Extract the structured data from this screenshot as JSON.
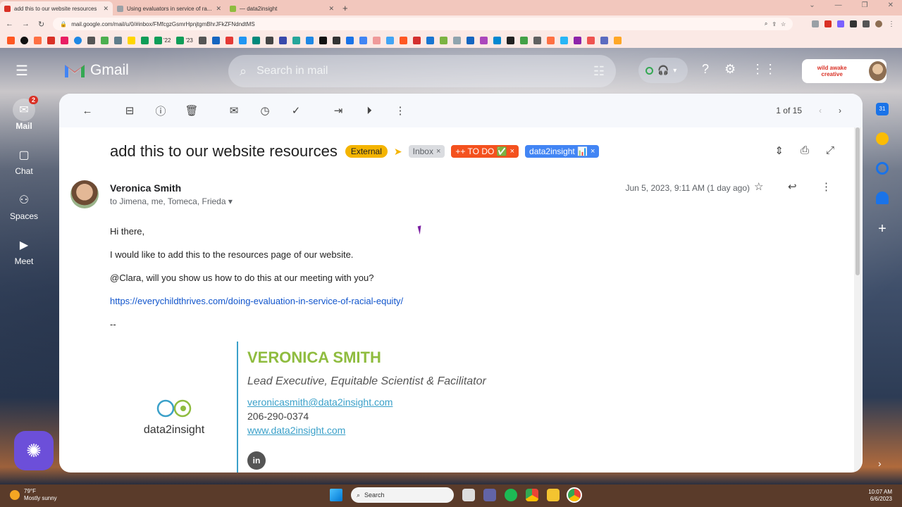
{
  "browser": {
    "tabs": [
      {
        "title": "add this to our website resources",
        "active": true,
        "favicon_color": "#d93025"
      },
      {
        "title": "Using evaluators in service of ra...",
        "active": false,
        "favicon_color": "#9aa0a6"
      },
      {
        "title": "— data2insight",
        "active": false,
        "favicon_color": "#8fbc3f"
      }
    ],
    "new_tab": "+",
    "url": "mail.google.com/mail/u/0/#inbox/FMfcgzGsmrHpnjtgmBhrJFkZFNdndtMS",
    "bookmark_labels": [
      "'22",
      "'23"
    ]
  },
  "gmail": {
    "brand": "Gmail",
    "search_placeholder": "Search in mail",
    "account_badge": "wild awake creative",
    "nav": [
      {
        "label": "Mail",
        "badge": "2",
        "icon": "mail-icon"
      },
      {
        "label": "Chat",
        "icon": "chat-icon"
      },
      {
        "label": "Spaces",
        "icon": "spaces-icon"
      },
      {
        "label": "Meet",
        "icon": "meet-icon"
      }
    ],
    "pager": "1 of 15"
  },
  "email": {
    "subject": "add this to our website resources",
    "labels": [
      {
        "text": "External",
        "bg": "#f4b400",
        "fg": "#202124",
        "removable": false
      },
      {
        "text": "Inbox",
        "bg": "#dadce0",
        "fg": "#5f6368",
        "removable": true
      },
      {
        "text": "++ TO DO ✅",
        "bg": "#f4511e",
        "fg": "#ffffff",
        "removable": true
      },
      {
        "text": "data2insight 📊",
        "bg": "#4285f4",
        "fg": "#ffffff",
        "removable": true
      }
    ],
    "sender_name": "Veronica Smith",
    "recipients": "to Jimena, me, Tomeca, Frieda",
    "date": "Jun 5, 2023, 9:11 AM (1 day ago)",
    "body": [
      "Hi there,",
      "I would like to add this to the resources page of our website.",
      "@Clara, will you show us how to do this at our meeting with you?"
    ],
    "link": "https://everychildthrives.com/doing-evaluation-in-service-of-racial-equity/",
    "sig_dash": "--",
    "signature": {
      "name": "VERONICA SMITH",
      "role": "Lead Executive, Equitable Scientist & Facilitator",
      "email": "veronicasmith@data2insight.com",
      "phone": "206-290-0374",
      "website": "www.data2insight.com",
      "logo_text": "data2insight",
      "linkedin": "in"
    }
  },
  "taskbar": {
    "temp": "79°F",
    "weather": "Mostly sunny",
    "search": "Search",
    "time": "10:07 AM",
    "date": "6/6/2023"
  },
  "colors": {
    "accent_blue": "#1155cc",
    "sig_green": "#8fbc3f",
    "sig_blue": "#3aa0c9",
    "compose": "#6c4fd9"
  }
}
